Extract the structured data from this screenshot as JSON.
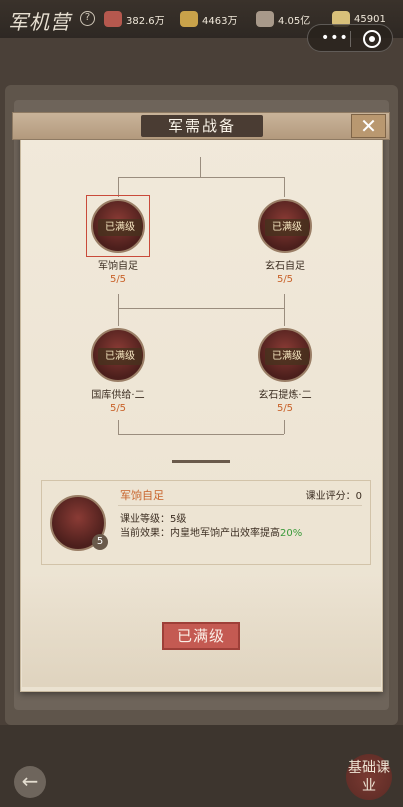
{
  "app": {
    "title": "军机营"
  },
  "resources": [
    {
      "icon": "gem-icon",
      "value": "382.6万"
    },
    {
      "icon": "gold-icon",
      "value": "4463万"
    },
    {
      "icon": "coin-stack-icon",
      "value": "4.05亿"
    },
    {
      "icon": "ingot-icon",
      "value": "45901"
    }
  ],
  "panel": {
    "title": "军需战备",
    "close_label": "✕"
  },
  "nodes": [
    {
      "name": "军饷自足",
      "badge": "已满级",
      "progress": "5/5",
      "selected": true
    },
    {
      "name": "玄石自足",
      "badge": "已满级",
      "progress": "5/5",
      "selected": false
    },
    {
      "name": "国库供给·二",
      "badge": "已满级",
      "progress": "5/5",
      "selected": false
    },
    {
      "name": "玄石提炼·二",
      "badge": "已满级",
      "progress": "5/5",
      "selected": false
    }
  ],
  "detail": {
    "name": "军饷自足",
    "score": "课业评分：0",
    "level_badge": "5",
    "level_line": "课业等级：5级",
    "effect_prefix": "当前效果：内皇地军饷产出效率提高",
    "effect_value": "20%"
  },
  "action": {
    "label": "已满级"
  },
  "bottom": {
    "back_label": "←",
    "stamp_text": "基础课业"
  },
  "colors": {
    "accent_red": "#c45a52",
    "progress_orange": "#c8622a",
    "effect_green": "#3a9a3a"
  }
}
